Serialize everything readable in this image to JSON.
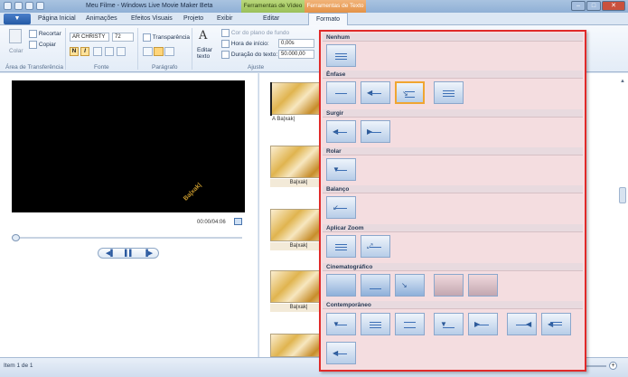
{
  "window": {
    "title": "Meu Filme - Windows Live Movie Maker Beta",
    "ctx_video": "Ferramentas de Vídeo",
    "ctx_text": "Ferramentas de Texto",
    "min": "–",
    "max": "□",
    "close": "✕"
  },
  "tabs": {
    "file": "▼",
    "items": [
      "Página Inicial",
      "Animações",
      "Efeitos Visuais",
      "Projeto",
      "Exibir",
      "Editar",
      "Formato"
    ]
  },
  "ribbon": {
    "clipboard": {
      "paste": "Colar",
      "cut": "Recortar",
      "copy": "Copiar",
      "label": "Área de Transferência"
    },
    "font": {
      "family": "AR CHRISTY",
      "size": "72",
      "bold": "N",
      "italic": "I",
      "label": "Fonte"
    },
    "paragraph": {
      "transparency": "Transparência",
      "label": "Parágrafo"
    },
    "adjust": {
      "edit_text": "Editar texto",
      "bg_color": "Cor do plano de fundo",
      "start_time_label": "Hora de início:",
      "start_time_value": "0,00s",
      "duration_label": "Duração do texto:",
      "duration_value": "50.000,00",
      "label": "Ajuste"
    }
  },
  "preview": {
    "watermark": "Ba|xak|",
    "timecode": "00:00/04:06",
    "prev": "◀▌",
    "play": "▌▌",
    "next": "▐▶"
  },
  "storyboard": {
    "title_caption": "A Ba|xak|",
    "clips": [
      "Ba|xak|",
      "Ba|xak|",
      "Ba|xak|",
      "Ba|xak|"
    ]
  },
  "gallery": {
    "sections": [
      {
        "name": "Nenhum",
        "count": 1
      },
      {
        "name": "Ênfase",
        "count": 4
      },
      {
        "name": "Surgir",
        "count": 2
      },
      {
        "name": "Rolar",
        "count": 1
      },
      {
        "name": "Balanço",
        "count": 1
      },
      {
        "name": "Aplicar Zoom",
        "count": 2
      },
      {
        "name": "Cinematográfico",
        "count": 5
      },
      {
        "name": "Contemporâneo",
        "count": 8
      }
    ],
    "selected": "Ênfase 3"
  },
  "status": {
    "text": "Item 1 de 1",
    "zoom_out": "−",
    "zoom_in": "+"
  }
}
